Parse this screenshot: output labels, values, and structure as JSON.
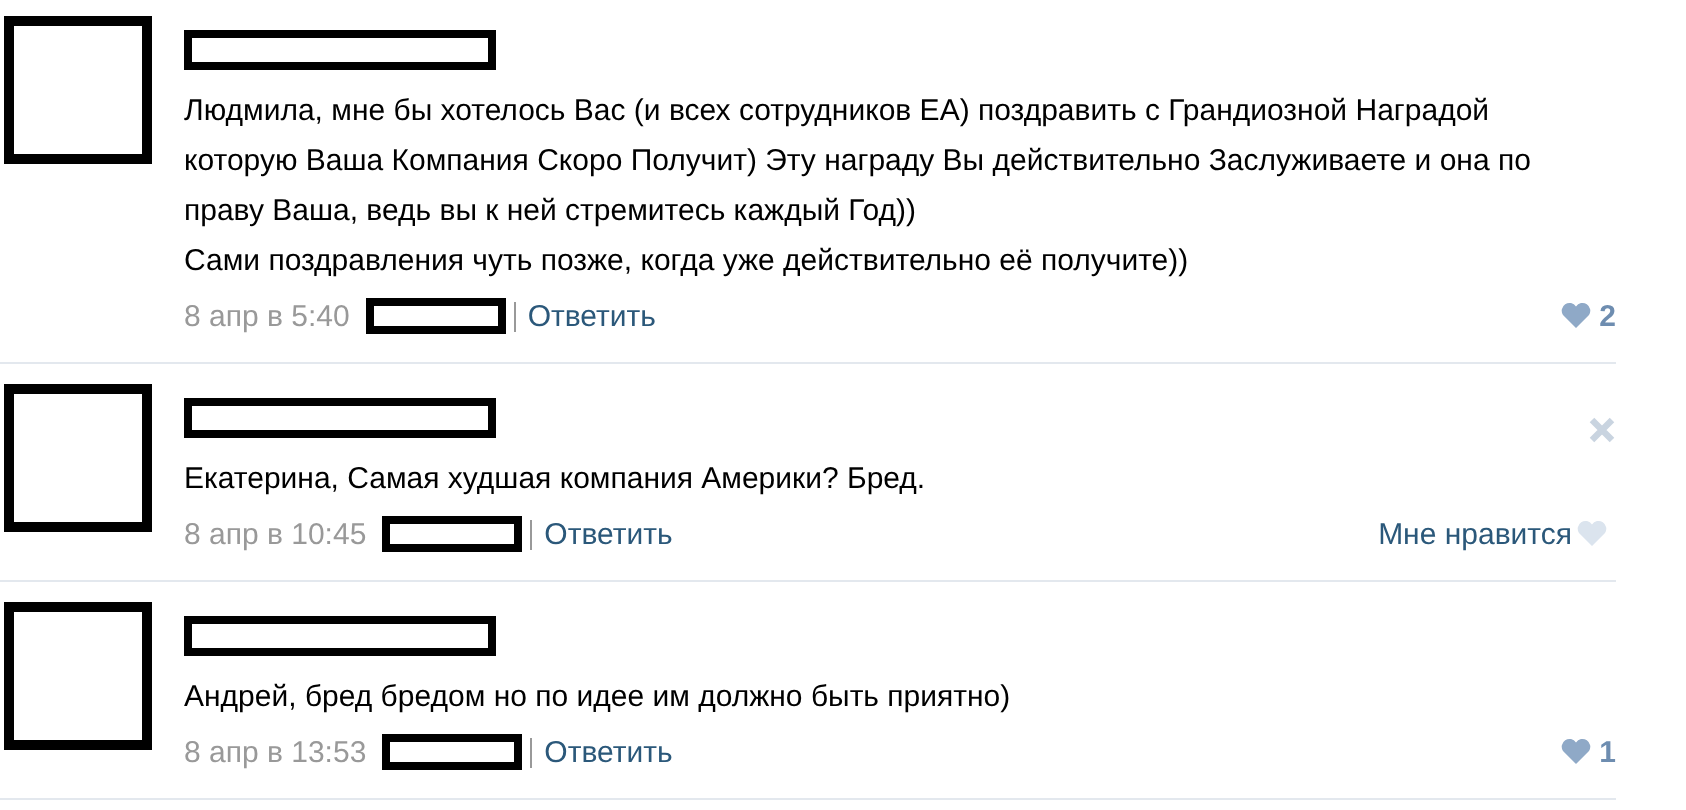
{
  "comments": [
    {
      "text": "Людмила, мне бы хотелось Вас (и всех сотрудников ЕА) поздравить с Грандиозной Наградой которую Ваша Компания Скоро Получит) Эту награду Вы действительно Заслуживаете и она по праву Ваша, ведь вы к ней стремитесь каждый Год))\nСами поздравления чуть позже, когда уже действительно её получите))",
      "date": "8 апр в 5:40",
      "reply": "Ответить",
      "like": {
        "kind": "count",
        "count": "2"
      },
      "close": false
    },
    {
      "text": "Екатерина, Самая худшая компания Америки? Бред.",
      "date": "8 апр в 10:45",
      "reply": "Ответить",
      "like": {
        "kind": "label",
        "label": "Мне нравится"
      },
      "close": true
    },
    {
      "text": "Андрей, бред бредом но по идее им должно быть приятно)",
      "date": "8 апр в 13:53",
      "reply": "Ответить",
      "like": {
        "kind": "count",
        "count": "1"
      },
      "close": false
    }
  ]
}
